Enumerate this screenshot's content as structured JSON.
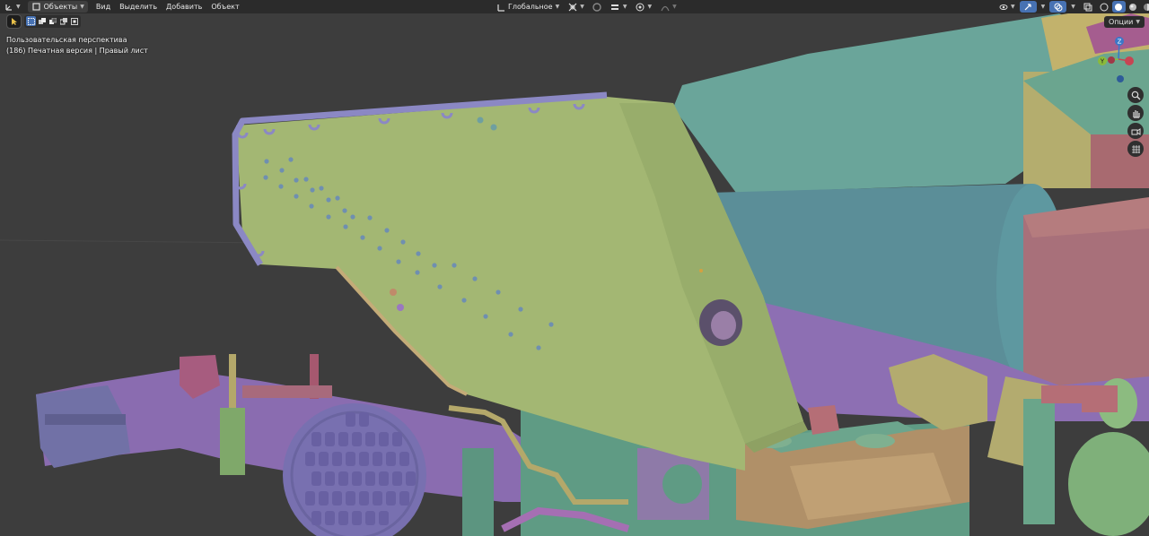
{
  "header": {
    "editor_type_icon": "axis-gizmo-icon",
    "mode_label": "Объекты",
    "menu": [
      "Вид",
      "Выделить",
      "Добавить",
      "Объект"
    ],
    "transform_orientation": "Глобальное",
    "icons_center": [
      "orientation-icon",
      "pivot-icon",
      "snap-icon",
      "snap-increment-icon",
      "proportional-edit-icon",
      "falloff-icon"
    ],
    "icons_right": [
      "visibility-icon",
      "gizmo-icon",
      "overlay-icon",
      "xray-icon",
      "shading-wireframe-icon",
      "shading-solid-icon",
      "shading-material-icon",
      "shading-rendered-icon"
    ]
  },
  "toolbar": {
    "active_tool": "select-box-icon",
    "select_modes": [
      "set-new-icon",
      "extend-icon",
      "subtract-icon",
      "invert-icon",
      "intersect-icon"
    ]
  },
  "viewport": {
    "perspective_label": "Пользовательская перспектива",
    "object_label": "(186) Печатная версия | Правый лист",
    "options_label": "Опции"
  },
  "gizmo": {
    "axes": [
      "Z",
      "Y",
      "X"
    ],
    "colors": {
      "x": "#c74553",
      "y": "#8bba3b",
      "z": "#3a77c9"
    }
  },
  "nav_buttons": [
    "zoom-icon",
    "pan-hand-icon",
    "camera-icon",
    "grid-ortho-icon"
  ],
  "colors": {
    "background": "#3d3d3d",
    "header": "#2b2b2b",
    "shield_green": "#a3b874",
    "rim_purple": "#8d89c6",
    "barrel_teal": "#5a8f94",
    "pink": "#a86a72",
    "chassis_purple": "#8a6fb0",
    "olive": "#b3ab6f"
  }
}
